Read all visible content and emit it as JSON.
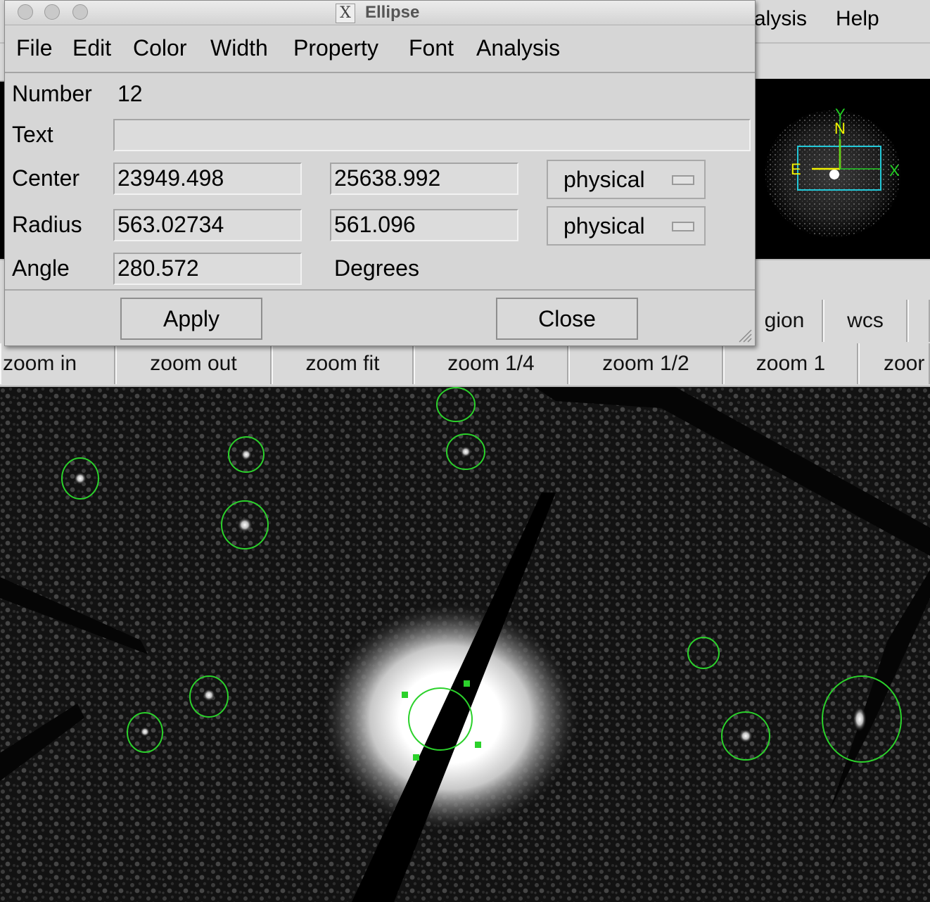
{
  "main_window": {
    "menu_visible": [
      "alysis",
      "Help"
    ],
    "row2_buttons": [
      "gion",
      "wcs"
    ],
    "zoom_buttons": [
      "zoom in",
      "zoom out",
      "zoom fit",
      "zoom 1/4",
      "zoom 1/2",
      "zoom 1",
      "zoor"
    ]
  },
  "panner": {
    "compass": {
      "y": "Y",
      "n": "N",
      "e": "E",
      "x": "X"
    }
  },
  "dialog": {
    "title": "Ellipse",
    "menu": [
      "File",
      "Edit",
      "Color",
      "Width",
      "Property",
      "Font",
      "Analysis"
    ],
    "number_label": "Number",
    "number_value": "12",
    "text_label": "Text",
    "text_value": "",
    "center_label": "Center",
    "center_x": "23949.498",
    "center_y": "25638.992",
    "center_system": "physical",
    "radius_label": "Radius",
    "radius_1": "563.02734",
    "radius_2": "561.096",
    "radius_system": "physical",
    "angle_label": "Angle",
    "angle_value": "280.572",
    "angle_unit": "Degrees",
    "apply_label": "Apply",
    "close_label": "Close"
  },
  "colors": {
    "region_green": "#2bd12b",
    "panner_box": "#22c8d8",
    "compass_yellow": "#f2f200",
    "compass_green": "#22d022"
  }
}
